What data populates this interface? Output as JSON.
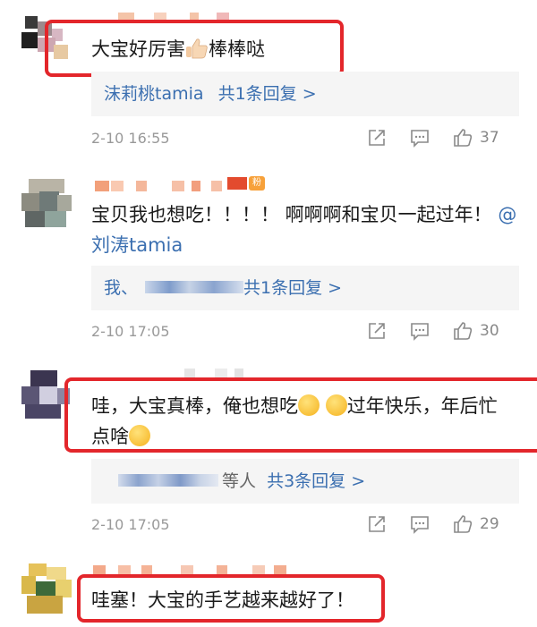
{
  "comments": [
    {
      "text": "大宝好厉害",
      "text_after": "棒棒哒",
      "reply_name": "沫莉桃tamia",
      "reply_summary": "共1条回复 >",
      "time": "2-10 16:55",
      "likes": "37"
    },
    {
      "text": "宝贝我也想吃！！！！ 啊啊啊和宝贝一起过年！",
      "mention": "@刘涛tamia",
      "reply_prefix": "我、",
      "reply_summary": "共1条回复 >",
      "time": "2-10 17:05",
      "likes": "30",
      "fan_badge": "粉"
    },
    {
      "text_line1": "哇，大宝真棒，俺也想吃",
      "text_line1_after": "过年快乐，年后忙",
      "text_line2": "点啥",
      "reply_prefix": "等人",
      "reply_summary": "共3条回复 >",
      "time": "2-10 17:05",
      "likes": "29"
    },
    {
      "text": "哇塞！大宝的手艺越来越好了！"
    }
  ],
  "colors": {
    "highlight": "#e3262b",
    "link": "#3b6fb0",
    "reply_bg": "#f5f5f5"
  }
}
